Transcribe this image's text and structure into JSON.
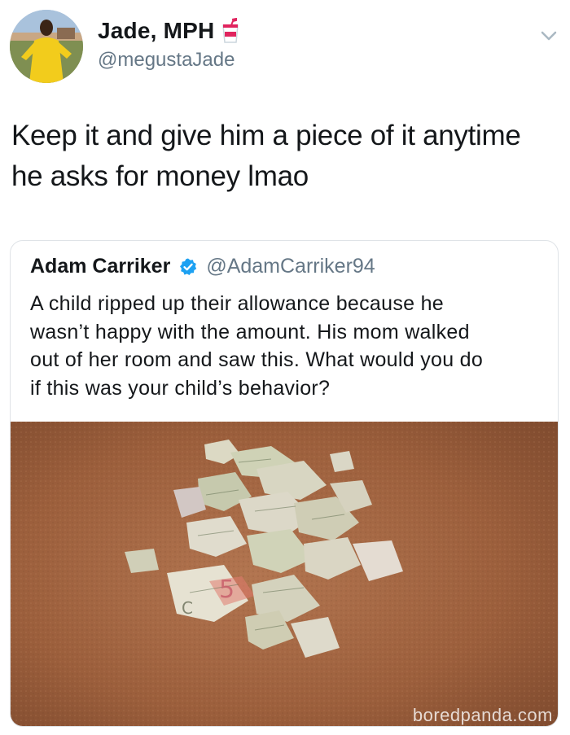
{
  "tweet": {
    "author": {
      "display_name": "Jade, MPH",
      "handle": "@megustaJade"
    },
    "text_lines": [
      "Keep it and give him a piece of it anytime",
      "he asks for money lmao"
    ],
    "menu_icon": "chevron-down-icon",
    "name_emoji": "cup-with-straw-icon"
  },
  "quoted_tweet": {
    "author": {
      "display_name": "Adam Carriker",
      "handle": "@AdamCarriker94",
      "verified": true
    },
    "text_lines": [
      "A child ripped up their allowance because he",
      "wasn’t happy with the amount. His mom walked",
      "out of her room and saw this. What would you do",
      "if this was your child’s behavior?"
    ],
    "image_alt": "torn dollar bills on carpet"
  },
  "watermark": "boredpanda.com",
  "colors": {
    "text": "#14171a",
    "secondary": "#657786",
    "verified": "#1da1f2",
    "border": "#dfe3e7",
    "carpet": "#a0633f"
  }
}
